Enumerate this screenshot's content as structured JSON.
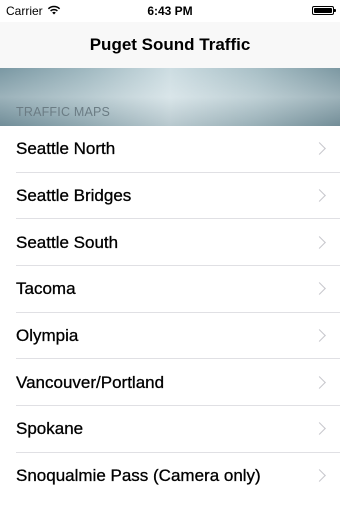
{
  "status_bar": {
    "carrier": "Carrier",
    "time": "6:43 PM"
  },
  "nav": {
    "title": "Puget Sound Traffic"
  },
  "section": {
    "header": "TRAFFIC MAPS"
  },
  "items": [
    {
      "label": "Seattle North"
    },
    {
      "label": "Seattle Bridges"
    },
    {
      "label": "Seattle South"
    },
    {
      "label": "Tacoma"
    },
    {
      "label": "Olympia"
    },
    {
      "label": "Vancouver/Portland"
    },
    {
      "label": "Spokane"
    },
    {
      "label": "Snoqualmie Pass (Camera only)"
    }
  ]
}
